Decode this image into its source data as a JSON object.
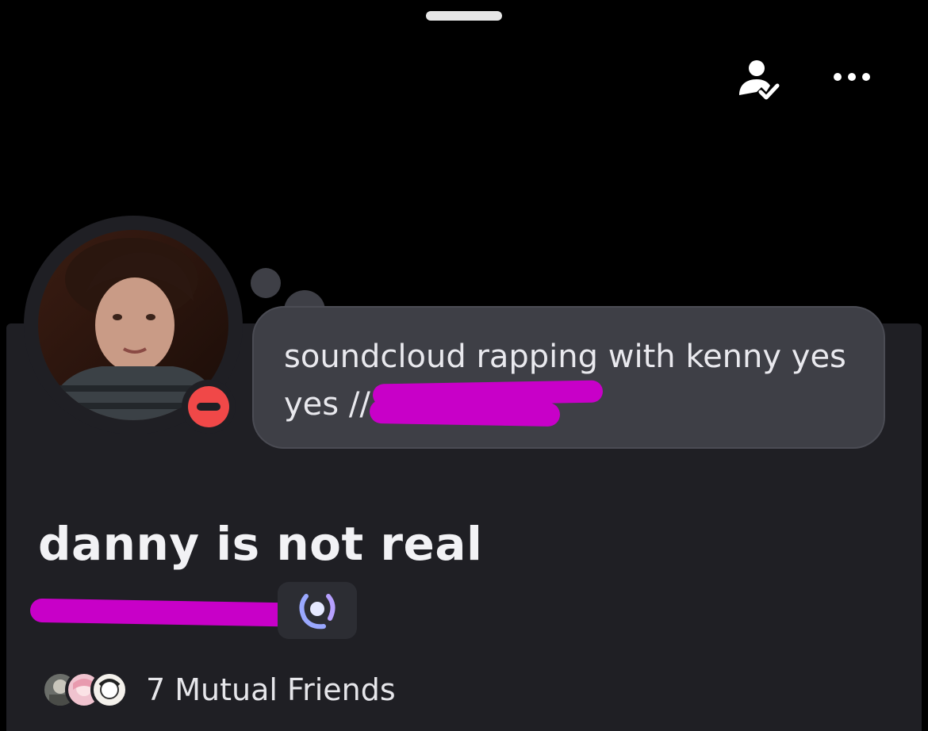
{
  "header": {
    "friend_icon": "person-check-icon",
    "more_icon": "ellipsis-icon"
  },
  "profile": {
    "status": "do-not-disturb",
    "status_color": "#f04848",
    "custom_status_line1": "soundcloud rapping with kenny yes",
    "custom_status_line2": "yes //",
    "display_name": "danny is not real",
    "badge_icon": "laurel-badge-icon"
  },
  "mutual": {
    "label": "7 Mutual Friends"
  },
  "colors": {
    "card_bg": "#1f1f24",
    "bubble_bg": "#3e3f46",
    "redaction": "#c800c8"
  }
}
